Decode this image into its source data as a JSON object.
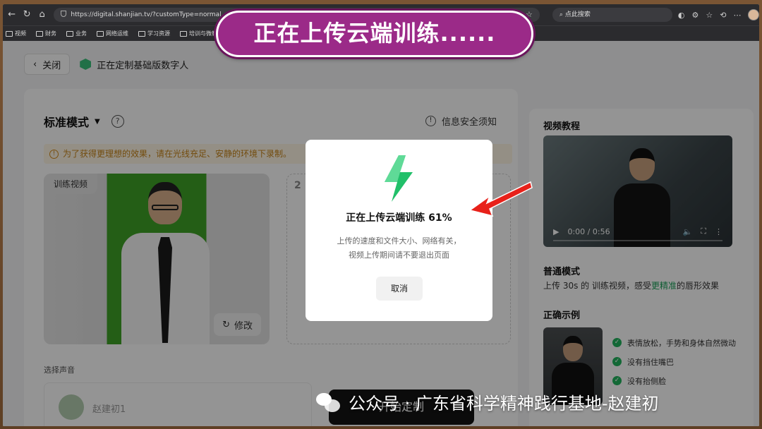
{
  "browser": {
    "url": "https://digital.shanjian.tv/?customType=normal",
    "search_placeholder": "点此搜索",
    "bookmarks": [
      "视频",
      "财务",
      "业务",
      "网络运维",
      "学习资源",
      "培训与微教"
    ]
  },
  "banner": {
    "text": "正在上传云端训练......"
  },
  "header": {
    "close_label": "关闭",
    "title": "正在定制基础版数字人"
  },
  "main": {
    "mode_label": "标准模式",
    "safety_label": "信息安全须知",
    "warning": "为了获得更理想的效果，请在光线充足、安静的环境下录制。",
    "video_tag": "训练视频",
    "edit_label": "修改",
    "upload_step": "2",
    "voice_label": "选择声音",
    "voice_name": "赵建初1",
    "start_label": "开始定制"
  },
  "side": {
    "tutorial_title": "视频教程",
    "video_time": "0:00 / 0:56",
    "normal_title": "普通模式",
    "normal_desc_pre": "上传 30s 的 训练视频，感受",
    "normal_desc_hl": "更精准",
    "normal_desc_post": "的唇形效果",
    "example_title": "正确示例",
    "checks": [
      "表情放松，手势和身体自然微动",
      "没有挡住嘴巴",
      "没有抬侧脸"
    ]
  },
  "dialog": {
    "title": "正在上传云端训练 61%",
    "progress_percent": 61,
    "desc_line1": "上传的速度和文件大小、网络有关，",
    "desc_line2": "视频上传期间请不要退出页面",
    "cancel_label": "取消"
  },
  "watermark": {
    "text": "公众号 · 广东省科学精神践行基地-赵建初"
  },
  "colors": {
    "banner": "#9b2a88",
    "accent_green": "#22b35e",
    "arrow_red": "#e8211a"
  }
}
